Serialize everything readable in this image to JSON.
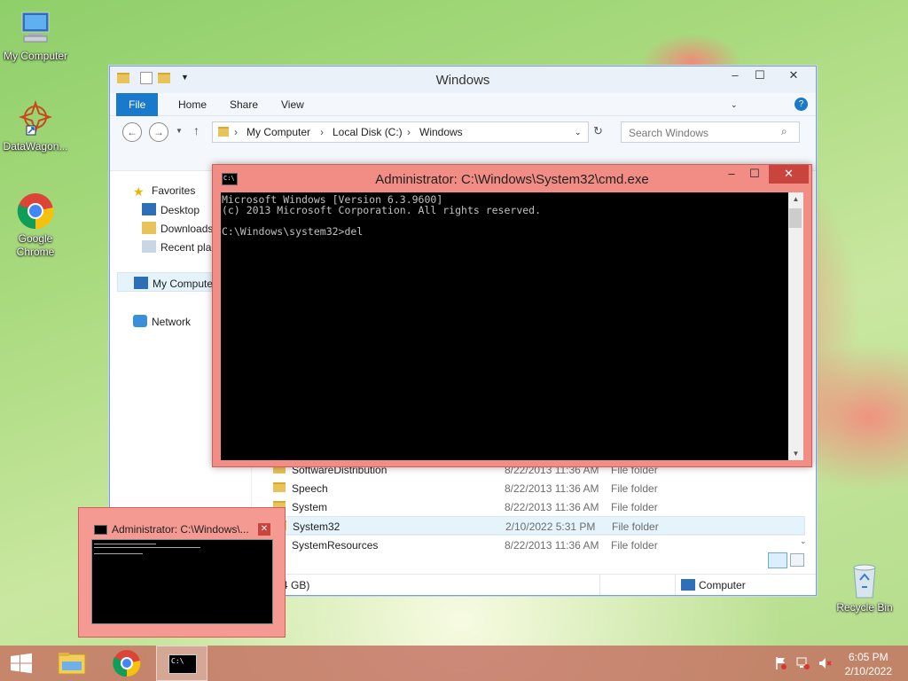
{
  "desktop": {
    "icons": [
      {
        "label": "My Computer",
        "icon": "computer-icon"
      },
      {
        "label": "DataWagon...",
        "icon": "datawagon-icon"
      },
      {
        "label": "Google Chrome",
        "icon": "chrome-icon"
      },
      {
        "label": "Recycle Bin",
        "icon": "recycle-bin-icon"
      }
    ]
  },
  "explorer": {
    "title": "Windows",
    "tabs": [
      "File",
      "Home",
      "Share",
      "View"
    ],
    "breadcrumb": [
      "My Computer",
      "Local Disk (C:)",
      "Windows"
    ],
    "search_placeholder": "Search Windows",
    "nav": {
      "favorites": "Favorites",
      "desktop": "Desktop",
      "downloads": "Downloads",
      "recent": "Recent plac",
      "my_computer": "My Compute",
      "network": "Network"
    },
    "files": [
      {
        "name": "SoftwareDistribution",
        "date": "8/22/2013 11:36 AM",
        "type": "File folder"
      },
      {
        "name": "Speech",
        "date": "8/22/2013 11:36 AM",
        "type": "File folder"
      },
      {
        "name": "System",
        "date": "8/22/2013 11:36 AM",
        "type": "File folder"
      },
      {
        "name": "System32",
        "date": "2/10/2022 5:31 PM",
        "type": "File folder"
      },
      {
        "name": "SystemResources",
        "date": "8/22/2013 11:36 AM",
        "type": "File folder"
      }
    ],
    "status_left": "4 GB)",
    "status_right": "Computer"
  },
  "cmd": {
    "title": "Administrator: C:\\Windows\\System32\\cmd.exe",
    "icon_text": "C:\\",
    "lines": [
      "Microsoft Windows [Version 6.3.9600]",
      "(c) 2013 Microsoft Corporation. All rights reserved.",
      "",
      "C:\\Windows\\system32>del"
    ]
  },
  "thumbnail": {
    "title": "Administrator: C:\\Windows\\...",
    "close": "✕"
  },
  "taskbar": {
    "time": "6:05 PM",
    "date": "2/10/2022"
  }
}
